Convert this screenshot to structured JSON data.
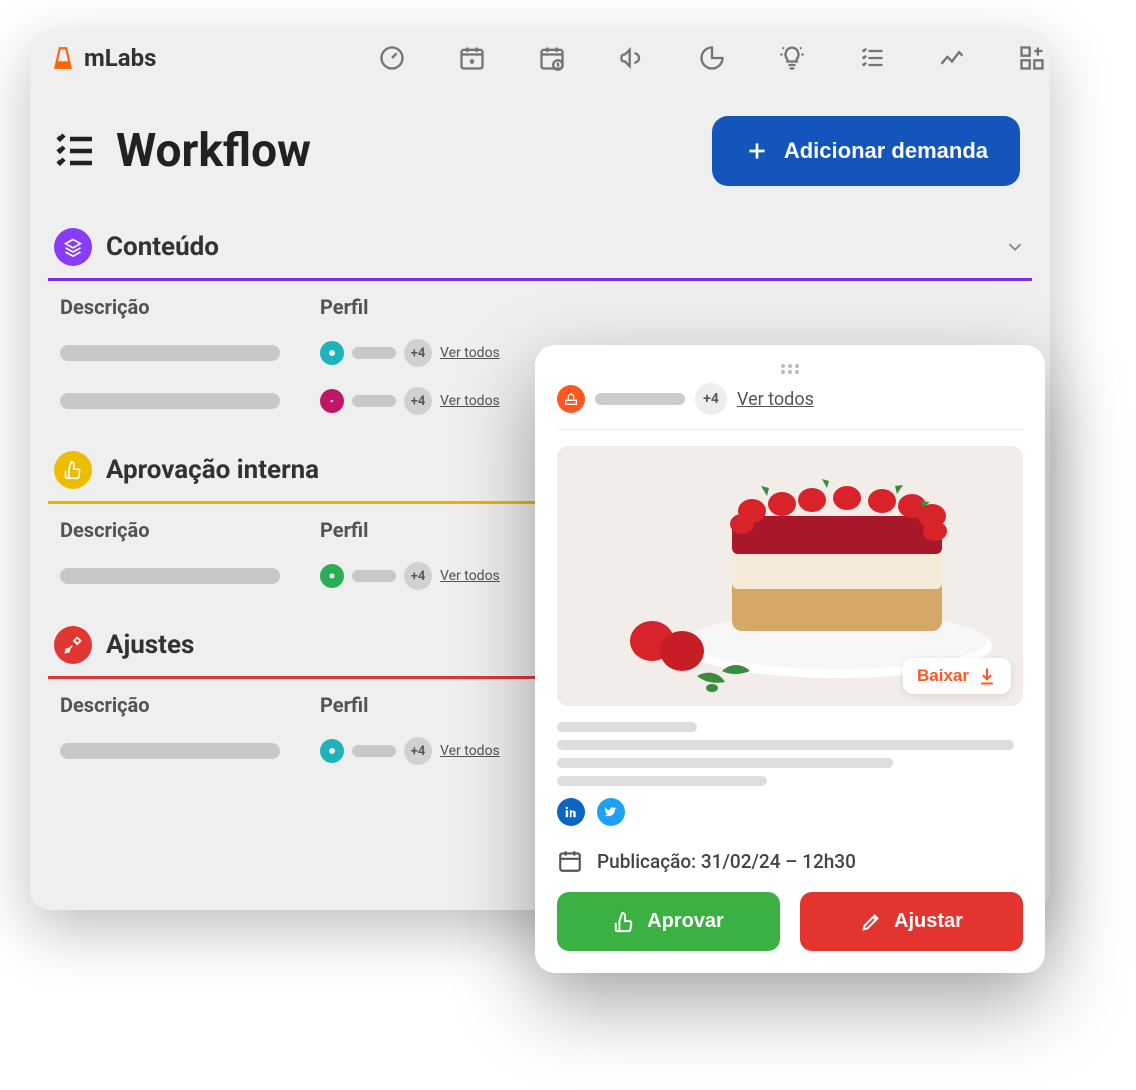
{
  "app": {
    "name": "mLabs"
  },
  "page": {
    "title": "Workflow"
  },
  "buttons": {
    "add_demand": "Adicionar demanda"
  },
  "columns": {
    "desc": "Descrição",
    "perfil": "Perfil"
  },
  "common": {
    "ver_todos": "Ver todos",
    "plus4": "+4"
  },
  "sections": [
    {
      "title": "Conteúdo",
      "color": "#8a3ffc",
      "divider": "#7b2ff7"
    },
    {
      "title": "Aprovação interna",
      "color": "#f2c200",
      "divider": "#f2b900"
    },
    {
      "title": "Ajustes",
      "color": "#e53935",
      "divider": "#e53935"
    }
  ],
  "card": {
    "ver_todos": "Ver todos",
    "plus4": "+4",
    "download": "Baixar",
    "publication_label": "Publicação: 31/02/24 – 12h30",
    "approve": "Aprovar",
    "adjust": "Ajustar"
  }
}
